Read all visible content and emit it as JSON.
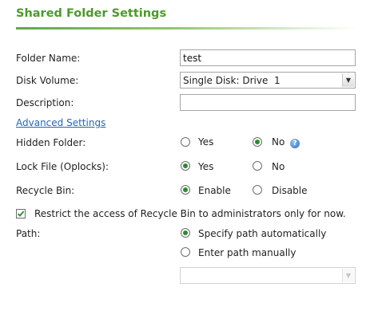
{
  "header": {
    "title": "Shared Folder Settings"
  },
  "fields": {
    "folder_name": {
      "label": "Folder Name:",
      "value": "test"
    },
    "disk_volume": {
      "label": "Disk Volume:",
      "value": "Single Disk: Drive  1"
    },
    "description": {
      "label": "Description:",
      "value": ""
    }
  },
  "advanced_link": "Advanced Settings",
  "hidden_folder": {
    "label": "Hidden Folder:",
    "yes": "Yes",
    "no": "No",
    "selected": "no",
    "help_icon": "?"
  },
  "lock_file": {
    "label": "Lock File (Oplocks):",
    "yes": "Yes",
    "no": "No",
    "selected": "yes"
  },
  "recycle_bin": {
    "label": "Recycle Bin:",
    "enable": "Enable",
    "disable": "Disable",
    "selected": "enable"
  },
  "restrict_recycle": {
    "label": "Restrict the access of Recycle Bin to administrators only for now.",
    "checked": true
  },
  "path": {
    "label": "Path:",
    "auto": "Specify path automatically",
    "manual": "Enter path manually",
    "selected": "auto",
    "manual_value": ""
  },
  "colors": {
    "title": "#4c9a2a",
    "link": "#2266bb",
    "radio_dot": "#2a8d2a"
  },
  "icons": {
    "dropdown": "chevron-down-icon",
    "help": "help-icon",
    "check": "checkmark-icon"
  }
}
